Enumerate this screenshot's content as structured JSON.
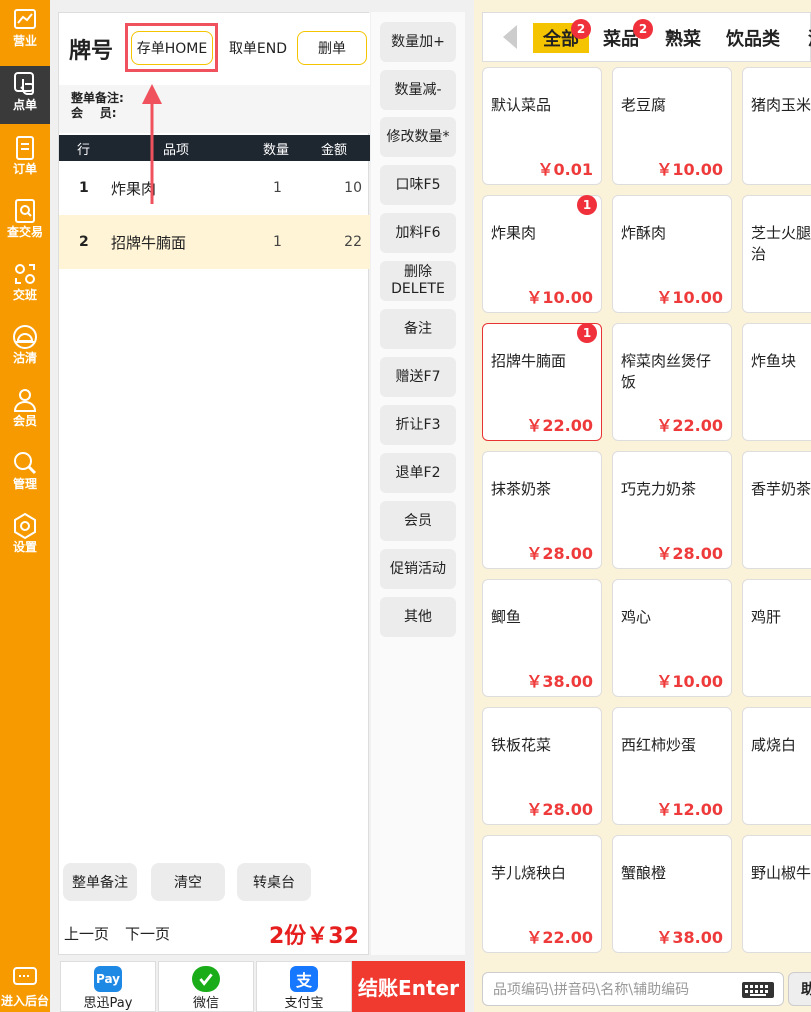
{
  "nav": {
    "items": [
      {
        "label": "营业",
        "icon": "chart-icon"
      },
      {
        "label": "点单",
        "icon": "touch-icon",
        "active": true
      },
      {
        "label": "订单",
        "icon": "document-icon"
      },
      {
        "label": "查交易",
        "icon": "search-doc-icon"
      },
      {
        "label": "交班",
        "icon": "shift-icon"
      },
      {
        "label": "沽清",
        "icon": "cloche-icon"
      },
      {
        "label": "会员",
        "icon": "user-icon"
      },
      {
        "label": "管理",
        "icon": "wrench-icon"
      },
      {
        "label": "设置",
        "icon": "gear-icon"
      }
    ],
    "bottom_label": "进入后台"
  },
  "order": {
    "title": "牌号",
    "store_btn": "存单HOME",
    "fetch_btn": "取单END",
    "delete_btn": "删单",
    "remark_label": "整单备注:",
    "member_label": "会    员:",
    "columns": [
      "行",
      "品项",
      "数量",
      "金额"
    ],
    "rows": [
      {
        "no": "1",
        "name": "炸果肉",
        "qty": "1",
        "amount": "10"
      },
      {
        "no": "2",
        "name": "招牌牛腩面",
        "qty": "1",
        "amount": "22",
        "selected": true
      }
    ],
    "footer_buttons": [
      "整单备注",
      "清空",
      "转桌台"
    ],
    "prev_page": "上一页",
    "next_page": "下一页",
    "total": "2份￥32"
  },
  "actions": [
    "数量加+",
    "数量减-",
    "修改数量*",
    "口味F5",
    "加料F6",
    "删除 DELETE",
    "备注",
    "赠送F7",
    "折让F3",
    "退单F2",
    "会员",
    "促销活动",
    "其他"
  ],
  "payment": {
    "methods": [
      {
        "label": "思迅Pay",
        "icon": "pay-icon",
        "color": "#1e88e5"
      },
      {
        "label": "微信",
        "icon": "wechat-check-icon",
        "color": "#1aad19"
      },
      {
        "label": "支付宝",
        "icon": "alipay-icon",
        "color": "#1677ff"
      }
    ],
    "pay_icon_text": "Pay",
    "alipay_icon_text": "支",
    "checkout": "结账Enter"
  },
  "menu": {
    "tabs": [
      {
        "label": "全部",
        "badge": "2",
        "active": true
      },
      {
        "label": "菜品",
        "badge": "2"
      },
      {
        "label": "熟菜"
      },
      {
        "label": "饮品类"
      },
      {
        "label": "酒"
      }
    ],
    "items": [
      {
        "name": "默认菜品",
        "price": "￥0.01"
      },
      {
        "name": "老豆腐",
        "price": "￥10.00"
      },
      {
        "name": "猪肉玉米",
        "price": "￥"
      },
      {
        "name": "炸果肉",
        "price": "￥10.00",
        "badge": "1"
      },
      {
        "name": "炸酥肉",
        "price": "￥10.00"
      },
      {
        "name": "芝士火腿三明治",
        "price": "￥"
      },
      {
        "name": "招牌牛腩面",
        "price": "￥22.00",
        "badge": "1",
        "selected": true
      },
      {
        "name": "榨菜肉丝煲仔饭",
        "price": "￥22.00"
      },
      {
        "name": "炸鱼块",
        "price": "￥"
      },
      {
        "name": "抹茶奶茶",
        "price": "￥28.00"
      },
      {
        "name": "巧克力奶茶",
        "price": "￥28.00"
      },
      {
        "name": "香芋奶茶",
        "price": "￥"
      },
      {
        "name": "鲫鱼",
        "price": "￥38.00"
      },
      {
        "name": "鸡心",
        "price": "￥10.00"
      },
      {
        "name": "鸡肝",
        "price": "￥"
      },
      {
        "name": "铁板花菜",
        "price": "￥28.00"
      },
      {
        "name": "西红柿炒蛋",
        "price": "￥12.00"
      },
      {
        "name": "咸烧白",
        "price": "￥"
      },
      {
        "name": "芋儿烧秧白",
        "price": "￥22.00"
      },
      {
        "name": "蟹酿橙",
        "price": "￥38.00"
      },
      {
        "name": "野山椒牛",
        "price": "￥"
      }
    ],
    "search_placeholder": "品项编码\\拼音码\\名称\\辅助编码",
    "search_btn": "助"
  }
}
